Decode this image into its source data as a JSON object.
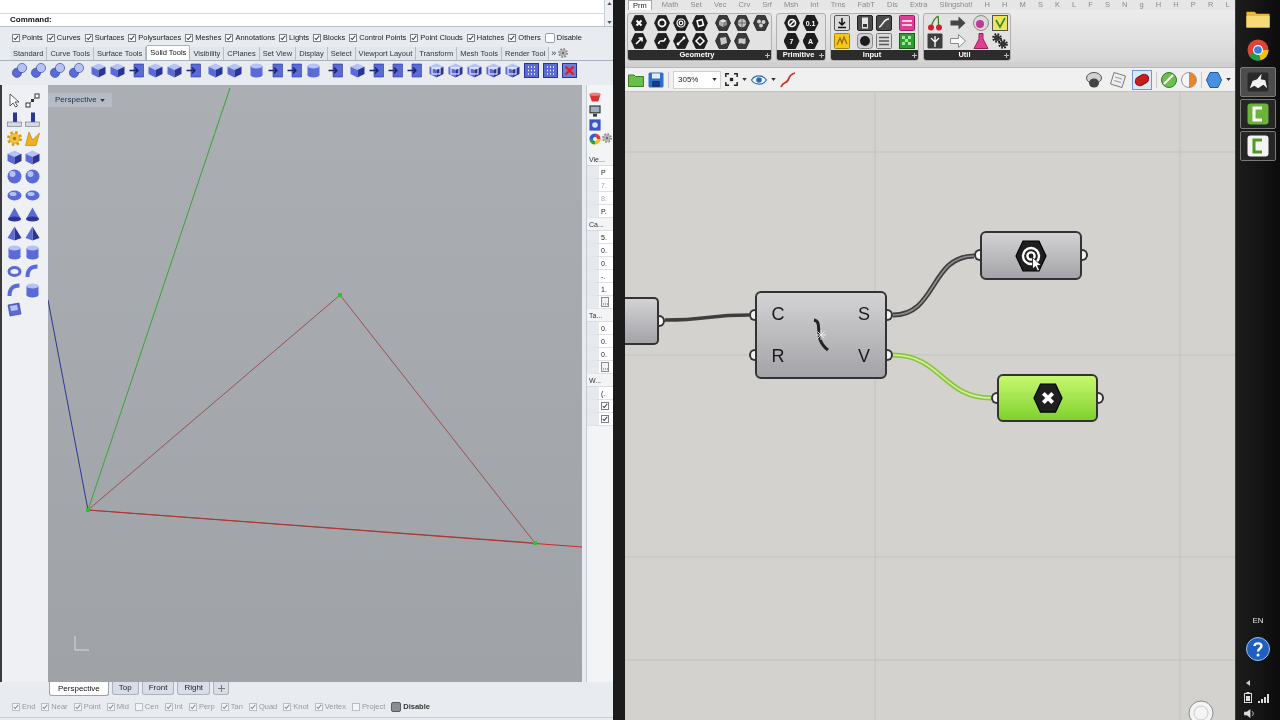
{
  "rhino": {
    "command_line": {
      "label": "Command:"
    },
    "filter_bar": {
      "items": [
        {
          "label": "Points",
          "checked": true
        },
        {
          "label": "Curves",
          "checked": true
        },
        {
          "label": "Surfaces",
          "checked": true
        },
        {
          "label": "Polysurfaces",
          "checked": true
        },
        {
          "label": "Meshes",
          "checked": true
        },
        {
          "label": "Annotations",
          "checked": true
        },
        {
          "label": "Lights",
          "checked": true
        },
        {
          "label": "Blocks",
          "checked": true
        },
        {
          "label": "Control Points",
          "checked": true
        },
        {
          "label": "Point Clouds",
          "checked": true
        },
        {
          "label": "Hatches",
          "checked": true
        },
        {
          "label": "Others",
          "checked": true
        }
      ],
      "disable": {
        "label": "Disable",
        "checked": false
      }
    },
    "toolbar_tabs": [
      {
        "label": "Standard",
        "selected": false
      },
      {
        "label": "Curve Tools",
        "selected": false
      },
      {
        "label": "Surface Tools",
        "selected": false
      },
      {
        "label": "Solid Tools",
        "selected": true
      },
      {
        "label": "Visibility",
        "selected": false
      },
      {
        "label": "CPlanes",
        "selected": false
      },
      {
        "label": "Set View",
        "selected": false
      },
      {
        "label": "Display",
        "selected": false
      },
      {
        "label": "Select",
        "selected": false
      },
      {
        "label": "Viewport Layout",
        "selected": false
      },
      {
        "label": "Transform",
        "selected": false
      },
      {
        "label": "Mesh Tools",
        "selected": false
      },
      {
        "label": "Render Tool",
        "selected": false
      }
    ],
    "tabs_overflow": "»",
    "viewport": {
      "title": "Perspective"
    },
    "properties": {
      "sections": [
        {
          "heading": "Vie...",
          "rows": [
            {
              "kind": "text",
              "value": "P",
              "disabled": false
            },
            {
              "kind": "text",
              "value": "7.",
              "disabled": true
            },
            {
              "kind": "text",
              "value": "8.",
              "disabled": true
            },
            {
              "kind": "text",
              "value": "P.",
              "disabled": false
            }
          ]
        },
        {
          "heading": "Ca...",
          "rows": [
            {
              "kind": "text",
              "value": "5.",
              "disabled": false
            },
            {
              "kind": "text",
              "value": "0.",
              "disabled": false
            },
            {
              "kind": "text",
              "value": "0.",
              "disabled": false
            },
            {
              "kind": "text",
              "value": "-.",
              "disabled": false
            },
            {
              "kind": "text",
              "value": "1.",
              "disabled": false
            },
            {
              "kind": "button"
            }
          ]
        },
        {
          "heading": "Ta...",
          "rows": [
            {
              "kind": "text",
              "value": "0.",
              "disabled": false
            },
            {
              "kind": "text",
              "value": "0.",
              "disabled": false
            },
            {
              "kind": "text",
              "value": "0.",
              "disabled": false
            },
            {
              "kind": "button"
            }
          ]
        },
        {
          "heading": "W...",
          "rows": [
            {
              "kind": "text",
              "value": "(.",
              "disabled": false
            },
            {
              "kind": "checkbox",
              "checked": true
            },
            {
              "kind": "checkbox",
              "checked": true
            }
          ]
        }
      ]
    },
    "viewport_tabs": [
      {
        "label": "Perspective",
        "selected": true
      },
      {
        "label": "Top",
        "selected": false
      },
      {
        "label": "Front",
        "selected": false
      },
      {
        "label": "Right",
        "selected": false
      }
    ],
    "osnap_bar": {
      "items": [
        {
          "label": "End",
          "checked": true
        },
        {
          "label": "Near",
          "checked": true
        },
        {
          "label": "Point",
          "checked": true
        },
        {
          "label": "Mid",
          "checked": true
        },
        {
          "label": "Cen",
          "checked": false
        },
        {
          "label": "Int",
          "checked": true
        },
        {
          "label": "Perp",
          "checked": true
        },
        {
          "label": "Tan",
          "checked": true
        },
        {
          "label": "Quad",
          "checked": true
        },
        {
          "label": "Knot",
          "checked": true
        },
        {
          "label": "Vertex",
          "checked": true
        },
        {
          "label": "Project",
          "checked": false
        }
      ],
      "disable": {
        "label": "Disable",
        "checked": true
      }
    }
  },
  "grasshopper": {
    "tabs": [
      {
        "label": "Prm",
        "selected": true
      },
      {
        "label": "Math",
        "selected": false
      },
      {
        "label": "Set",
        "selected": false
      },
      {
        "label": "Vec",
        "selected": false
      },
      {
        "label": "Crv",
        "selected": false
      },
      {
        "label": "Srf",
        "selected": false
      },
      {
        "label": "Msh",
        "selected": false
      },
      {
        "label": "Int",
        "selected": false
      },
      {
        "label": "Trns",
        "selected": false
      },
      {
        "label": "FabT",
        "selected": false
      },
      {
        "label": "Dis",
        "selected": false
      },
      {
        "label": "Extra",
        "selected": false
      },
      {
        "label": "Slingshot!",
        "selected": false
      },
      {
        "label": "H",
        "selected": false
      },
      {
        "label": "H",
        "selected": false
      },
      {
        "label": "M",
        "selected": false
      },
      {
        "label": "S",
        "selected": false
      },
      {
        "label": "K",
        "selected": false
      },
      {
        "label": "L",
        "selected": false
      },
      {
        "label": "F",
        "selected": false
      },
      {
        "label": "S",
        "selected": false
      },
      {
        "label": "N",
        "selected": false
      },
      {
        "label": "g",
        "selected": false
      },
      {
        "label": "H",
        "selected": false
      },
      {
        "label": "H",
        "selected": false
      },
      {
        "label": "P",
        "selected": false
      },
      {
        "label": "R",
        "selected": false
      },
      {
        "label": "L",
        "selected": false
      }
    ],
    "panels": [
      {
        "label": "Geometry"
      },
      {
        "label": "Primitive",
        "glyphs": [
          "0.1",
          "7",
          "A"
        ]
      },
      {
        "label": "Input"
      },
      {
        "label": "Util"
      }
    ],
    "zoom": "305%",
    "preview_buttons": [
      {
        "selected": false
      },
      {
        "selected": false
      },
      {
        "selected": true
      }
    ],
    "canvas": {
      "components": [
        {
          "kind": "stub",
          "selected": false
        },
        {
          "kind": "component",
          "inputs": [
            "C",
            "R"
          ],
          "outputs": [
            "S",
            "V"
          ],
          "selected": false
        },
        {
          "kind": "spiral",
          "selected": false
        },
        {
          "kind": "cross",
          "selected": true
        }
      ]
    }
  },
  "taskbar": {
    "apps": [
      {
        "kind": "folder",
        "running": false,
        "selected": false
      },
      {
        "kind": "browser",
        "running": false,
        "selected": false
      },
      {
        "kind": "rhino",
        "running": true,
        "selected": true
      },
      {
        "kind": "capture",
        "running": true,
        "selected": false
      },
      {
        "kind": "editor",
        "running": true,
        "selected": false
      }
    ],
    "language": "EN"
  }
}
